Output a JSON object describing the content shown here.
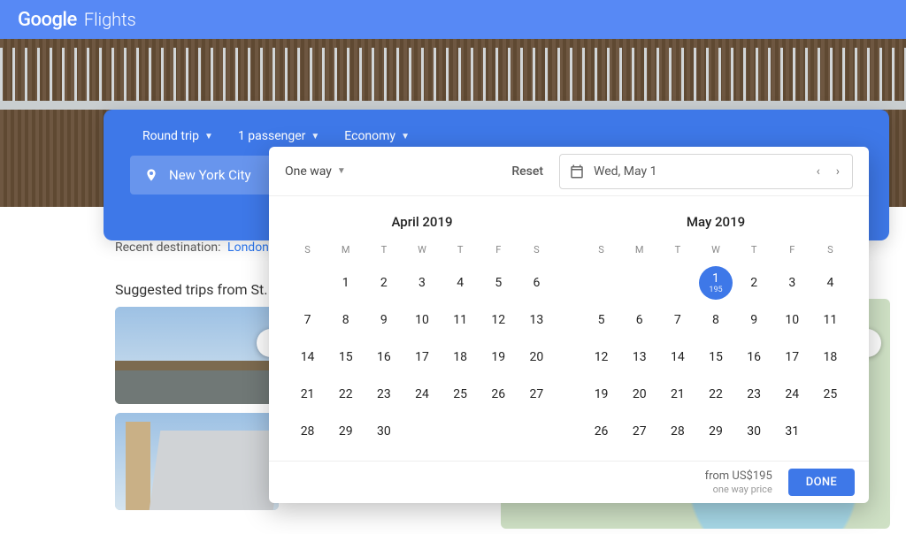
{
  "brand": {
    "google": "Google",
    "product": "Flights"
  },
  "trip": {
    "type": "Round trip",
    "passengers": "1 passenger",
    "cabin": "Economy"
  },
  "origin": "New York City",
  "recent": {
    "label": "Recent destination:",
    "link": "London"
  },
  "suggested_label": "Suggested trips from St. Joh",
  "picker": {
    "dropdown": "One way",
    "reset": "Reset",
    "date_display": "Wed, May 1",
    "footer_price": "from US$195",
    "footer_sub": "one way price",
    "done": "DONE",
    "dow": [
      "S",
      "M",
      "T",
      "W",
      "T",
      "F",
      "S"
    ],
    "months": [
      {
        "title": "April 2019",
        "lead_blanks": 1,
        "days": 30,
        "selected": null
      },
      {
        "title": "May 2019",
        "lead_blanks": 3,
        "days": 31,
        "selected": 1,
        "selected_price": "195"
      }
    ]
  }
}
